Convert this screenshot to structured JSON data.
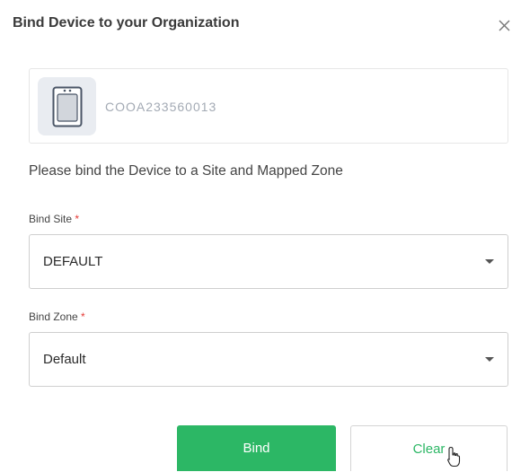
{
  "dialog": {
    "title": "Bind Device to your Organization",
    "close_icon": "close-icon"
  },
  "device": {
    "id": "COOA233560013",
    "icon": "device-tablet-icon"
  },
  "instruction": "Please bind the Device to a Site and Mapped Zone",
  "bind_site": {
    "label": "Bind Site",
    "required_mark": "*",
    "value": "DEFAULT"
  },
  "bind_zone": {
    "label": "Bind Zone",
    "required_mark": "*",
    "value": "Default"
  },
  "buttons": {
    "bind_label": "Bind",
    "clear_label": "Clear"
  },
  "colors": {
    "primary": "#2cb765",
    "required": "#e53935",
    "device_id": "#a3aab4"
  }
}
